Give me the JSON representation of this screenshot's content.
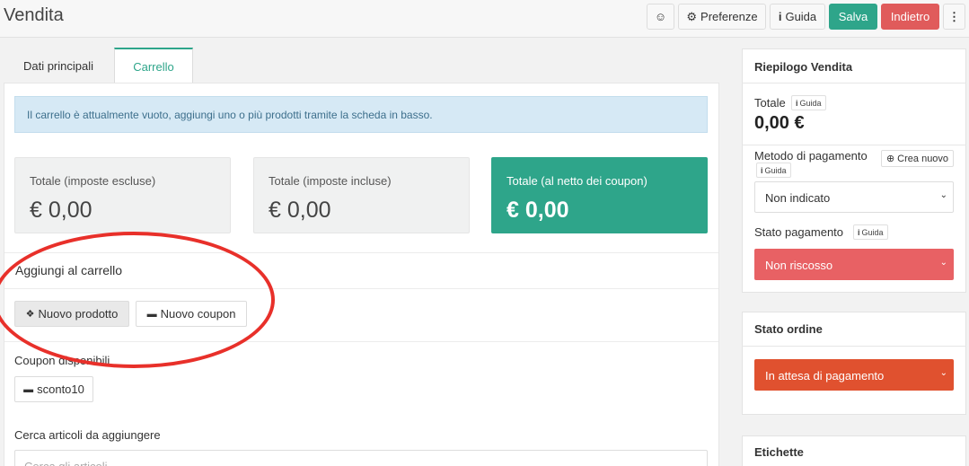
{
  "header": {
    "title": "Vendita",
    "preferenze": "Preferenze",
    "guida": "Guida",
    "salva": "Salva",
    "indietro": "Indietro"
  },
  "tabs": [
    {
      "label": "Dati principali",
      "active": false
    },
    {
      "label": "Carrello",
      "active": true
    }
  ],
  "cart": {
    "alert": "Il carrello è attualmente vuoto, aggiungi uno o più prodotti tramite la scheda in basso.",
    "totals": [
      {
        "label": "Totale (imposte escluse)",
        "value": "€ 0,00"
      },
      {
        "label": "Totale (imposte incluse)",
        "value": "€ 0,00"
      },
      {
        "label": "Totale (al netto dei coupon)",
        "value": "€ 0,00"
      }
    ],
    "add_title": "Aggiungi al carrello",
    "new_product": "Nuovo prodotto",
    "new_coupon": "Nuovo coupon",
    "coupons_title": "Coupon disponibili",
    "coupons": [
      "sconto10"
    ],
    "search_label": "Cerca articoli da aggiungere",
    "search_placeholder": "Cerca gli articoli"
  },
  "summary": {
    "title": "Riepilogo Vendita",
    "total_label": "Totale",
    "guida": "Guida",
    "total_value": "0,00 €",
    "payment_method_label": "Metodo di pagamento",
    "crea_nuovo": "Crea nuovo",
    "payment_method_value": "Non indicato",
    "payment_status_label": "Stato pagamento",
    "payment_status_value": "Non riscosso"
  },
  "order_status": {
    "title": "Stato ordine",
    "value": "In attesa di pagamento"
  },
  "labels_panel": {
    "title": "Etichette"
  },
  "colors": {
    "accent": "#2ea58a",
    "danger": "#e05b5b",
    "alert_bg": "#d6e9f5",
    "annotation": "#e8302a"
  }
}
